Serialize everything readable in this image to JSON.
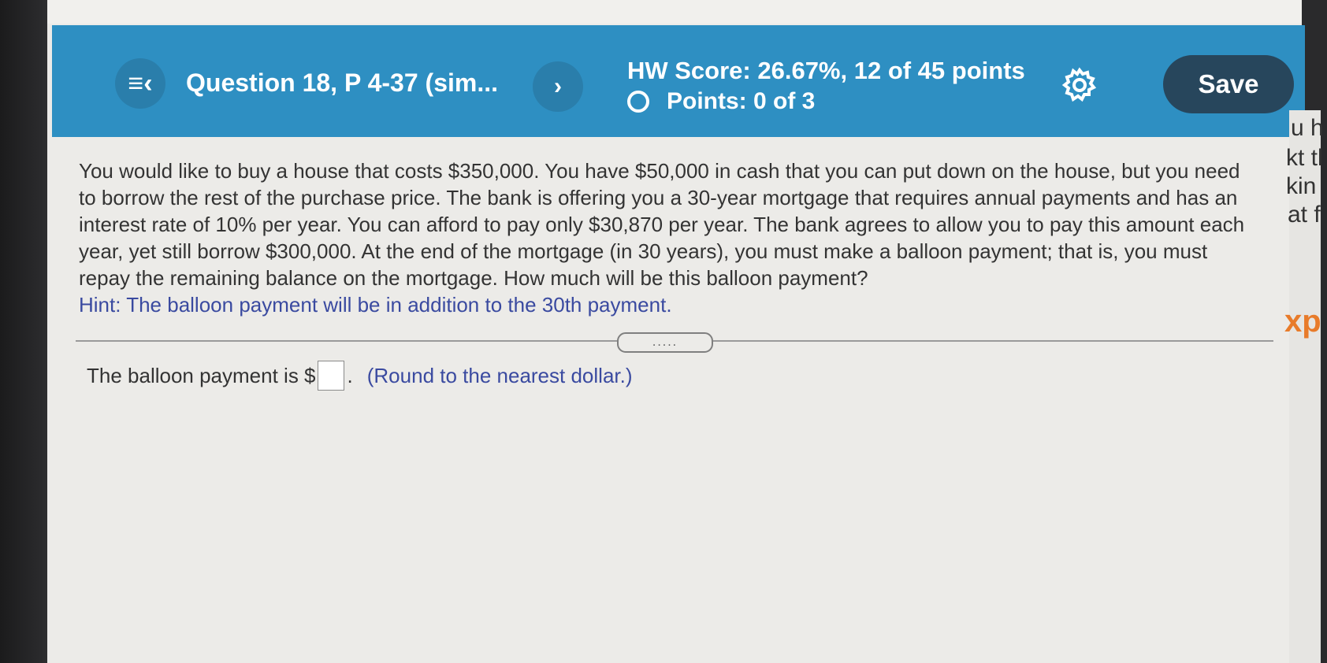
{
  "header": {
    "question_title": "Question 18, P 4-37 (sim...",
    "hw_score": "HW Score: 26.67%, 12 of 45 points",
    "points": "Points: 0 of 3",
    "save_label": "Save",
    "menu_icon": "list-collapse-icon",
    "next_icon": "chevron-right-icon",
    "settings_icon": "gear-icon"
  },
  "question": {
    "text": "You would like to buy a house that costs $350,000. You have $50,000 in cash that you can put down on the house, but you need to borrow the rest of the purchase price. The bank is offering you a 30-year mortgage that requires annual payments and has an interest rate of 10% per year. You can afford to pay only $30,870 per year. The bank agrees to allow you to pay this amount each year, yet still borrow $300,000. At the end of the mortgage (in 30 years), you must make a balloon payment; that is, you must repay the remaining balance on the mortgage. How much will be this balloon payment?",
    "hint": "Hint: The balloon payment will be in addition to the 30th payment."
  },
  "answer": {
    "prefix": "The balloon payment is $",
    "suffix": ".",
    "note": "(Round to the nearest dollar.)",
    "value": ""
  },
  "divider_handle": ".....",
  "side_fragments": [
    "u h",
    "kt tl",
    "kin",
    "at f",
    "xp"
  ],
  "colors": {
    "header_bg": "#2e8fc2",
    "save_bg": "#27465c",
    "hint_text": "#3a4aa0",
    "page_bg": "#ecebe8"
  }
}
